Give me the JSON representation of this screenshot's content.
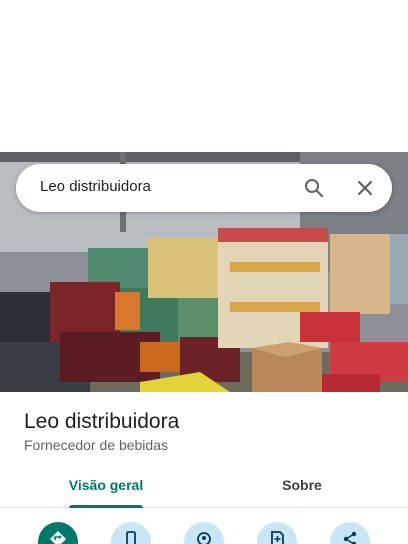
{
  "search": {
    "query": "Leo distribuidora"
  },
  "place": {
    "title": "Leo distribuidora",
    "category": "Fornecedor de bebidas"
  },
  "tabs": [
    {
      "label": "Visão geral",
      "active": true
    },
    {
      "label": "Sobre",
      "active": false
    }
  ],
  "actions": [
    {
      "icon": "directions-icon",
      "primary": true
    },
    {
      "icon": "phone-icon",
      "primary": false
    },
    {
      "icon": "nearby-icon",
      "primary": false
    },
    {
      "icon": "save-icon",
      "primary": false
    },
    {
      "icon": "share-icon",
      "primary": false
    }
  ],
  "colors": {
    "accent": "#00796b",
    "action_bg": "#c8e6f5",
    "secondary_text": "#5f6368"
  }
}
